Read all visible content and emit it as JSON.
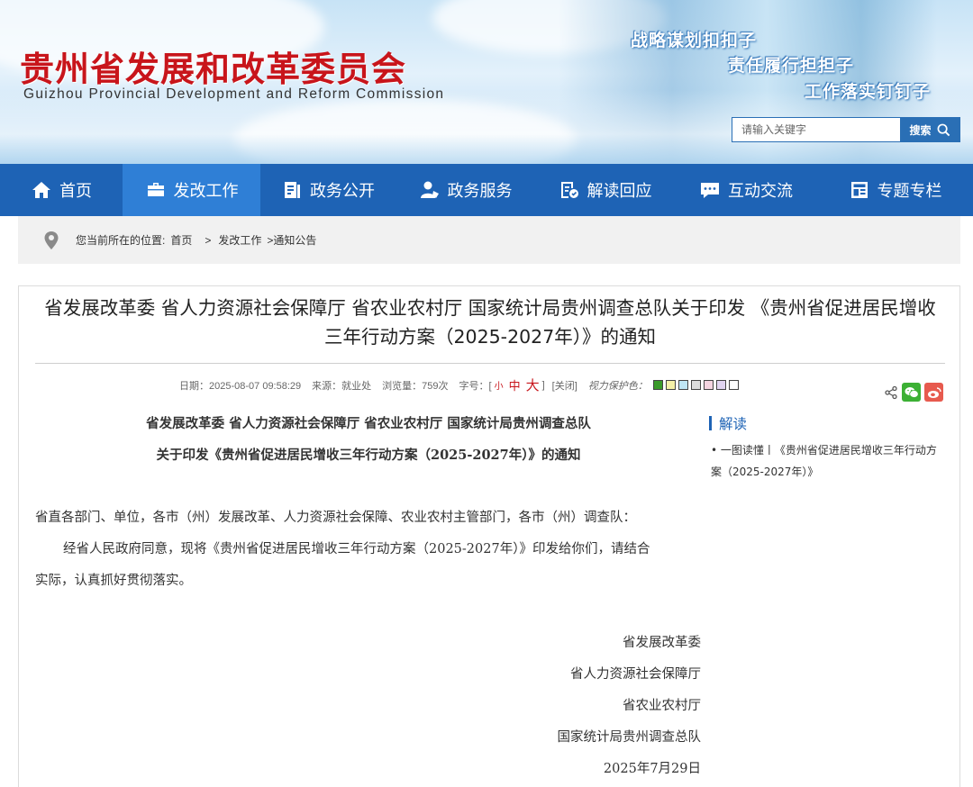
{
  "header": {
    "title_cn": "贵州省发展和改革委员会",
    "title_en": "Guizhou Provincial Development and Reform Commission",
    "slogans": [
      "战略谋划扣扣子",
      "责任履行担担子",
      "工作落实钉钉子"
    ],
    "search_placeholder": "请输入关键字",
    "search_button": "搜索"
  },
  "nav": {
    "items": [
      {
        "label": "首页",
        "icon": "home-icon"
      },
      {
        "label": "发改工作",
        "icon": "briefcase-icon"
      },
      {
        "label": "政务公开",
        "icon": "document-icon"
      },
      {
        "label": "政务服务",
        "icon": "user-service-icon"
      },
      {
        "label": "解读回应",
        "icon": "interpretation-icon"
      },
      {
        "label": "互动交流",
        "icon": "chat-icon"
      },
      {
        "label": "专题专栏",
        "icon": "column-icon"
      }
    ],
    "active_index": 1
  },
  "breadcrumb": {
    "prefix": "您当前所在的位置:",
    "items": [
      "首页",
      ">",
      "发改工作",
      ">通知公告"
    ]
  },
  "article": {
    "title_line1": "省发展改革委 省人力资源社会保障厅 省农业农村厅 国家统计局贵州调查总队关于印发 《贵州省促进居民增收",
    "title_line2": "三年行动方案（2025-2027年）》的通知",
    "meta": {
      "date": "日期：2025-08-07 09:58:29",
      "source": "来源：就业处",
      "views": "浏览量：759次",
      "font_size_label": "字号：[",
      "size_small": "小",
      "size_mid": "中",
      "size_big": "大",
      "size_close": "]",
      "close": "[关闭]",
      "vision_label": "视力保护色：",
      "swatches": [
        "#3a9a2a",
        "#f4f0a8",
        "#bfe6f5",
        "#dcdcdc",
        "#f4d4e0",
        "#e0d4f0",
        "#ffffff"
      ]
    },
    "doc_heading_1": "省发展改革委  省人力资源社会保障厅  省农业农村厅  国家统计局贵州调查总队",
    "doc_heading_2": "关于印发《贵州省促进居民增收三年行动方案（2025-2027年）》的通知",
    "salutation": "省直各部门、单位，各市（州）发展改革、人力资源社会保障、农业农村主管部门，各市（州）调查队：",
    "para1_line1": "经省人民政府同意，现将《贵州省促进居民增收三年行动方案（2025-2027年）》印发给你们，请结合",
    "para1_line2": "实际，认真抓好贯彻落实。",
    "signatures": [
      "省发展改革委",
      "省人力资源社会保障厅",
      "省农业农村厅",
      "国家统计局贵州调查总队"
    ],
    "sign_date": "2025年7月29日"
  },
  "sidebar": {
    "title": "解读",
    "link": "• 一图读懂丨《贵州省促进居民增收三年行动方案（2025-2027年）》"
  }
}
